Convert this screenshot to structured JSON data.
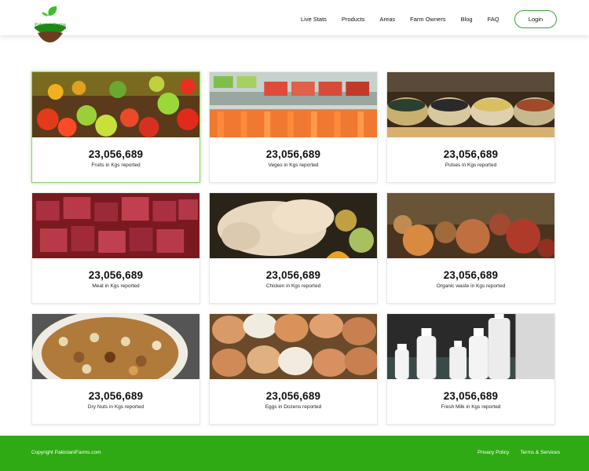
{
  "brand": {
    "name": "Pakistani Farms"
  },
  "nav": {
    "items": [
      "Live Stats",
      "Products",
      "Areas",
      "Farm Owners",
      "Blog",
      "FAQ"
    ],
    "login_label": "Login"
  },
  "cards": [
    {
      "value": "23,056,689",
      "label": "Fruits in Kgs reported",
      "image": "fruits-image"
    },
    {
      "value": "23,056,689",
      "label": "Veges in Kgs reported",
      "image": "vegetables-image"
    },
    {
      "value": "23,056,689",
      "label": "Pulses in Kgs reported",
      "image": "pulses-image"
    },
    {
      "value": "23,056,689",
      "label": "Meat in Kgs reported",
      "image": "meat-image"
    },
    {
      "value": "23,056,689",
      "label": "Chicken in Kgs reported",
      "image": "chicken-image"
    },
    {
      "value": "23,056,689",
      "label": "Organic waste in Kgs reported",
      "image": "organic-waste-image"
    },
    {
      "value": "23,056,689",
      "label": "Dry Nuts in Kgs reported",
      "image": "dry-nuts-image"
    },
    {
      "value": "23,056,689",
      "label": "Eggs in Dozens reported",
      "image": "eggs-image"
    },
    {
      "value": "23,056,689",
      "label": "Fresh Milk in Kgs reported",
      "image": "milk-image"
    }
  ],
  "footer": {
    "copyright": "Copyright PakistaniFarms.com",
    "links": [
      "Privacy Policy",
      "Terms & Services"
    ]
  },
  "colors": {
    "brand_green": "#2faa14",
    "active_border": "#8fd46a"
  }
}
